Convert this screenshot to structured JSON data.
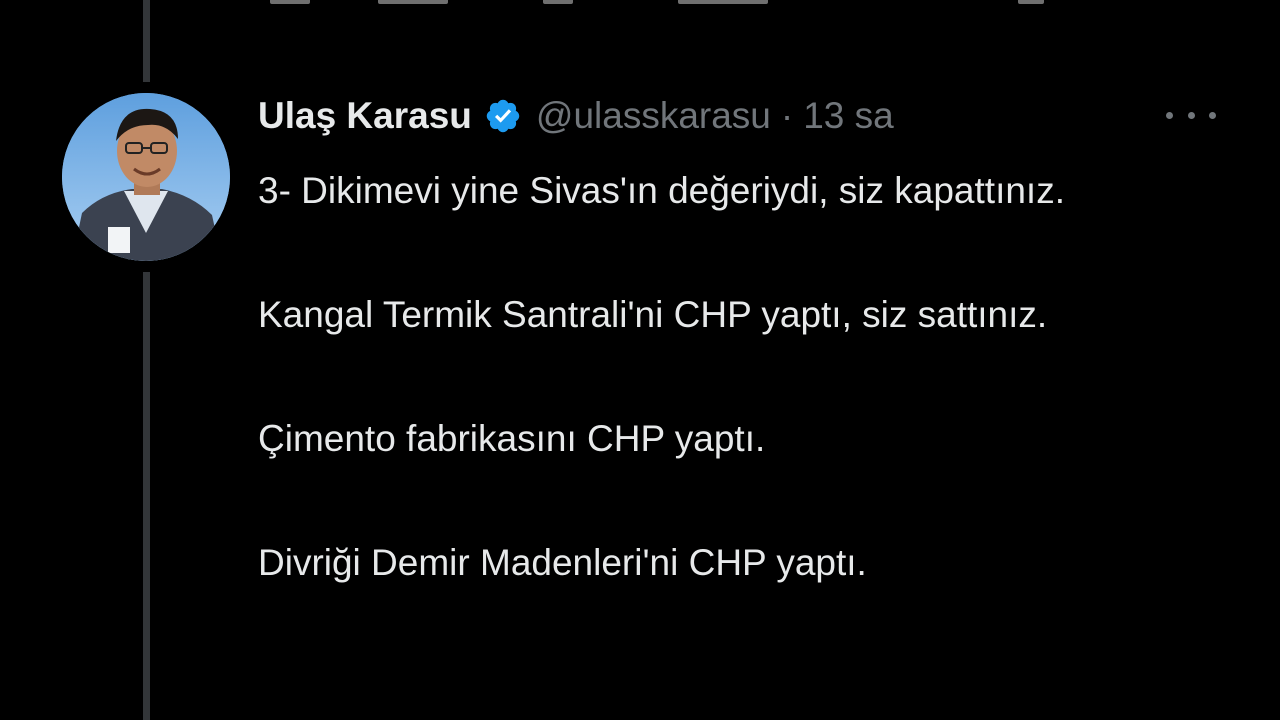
{
  "tweet": {
    "author_name": "Ulaş Karasu",
    "handle": "@ulasskarasu",
    "separator": "·",
    "timestamp": "13 sa",
    "verified": true,
    "paragraphs": [
      "3- Dikimevi yine Sivas'ın değeriydi, siz kapattınız.",
      "Kangal Termik Santrali'ni CHP yaptı, siz sattınız.",
      "Çimento fabrikasını CHP yaptı.",
      "Divriği Demir Madenleri'ni CHP yaptı."
    ]
  },
  "icons": {
    "verified": "verified-badge-icon",
    "more": "more-options-icon"
  },
  "colors": {
    "background": "#000000",
    "text_primary": "#e7e9ea",
    "text_secondary": "#71767b",
    "verified_blue": "#1d9bf0",
    "thread_line": "#333639"
  }
}
